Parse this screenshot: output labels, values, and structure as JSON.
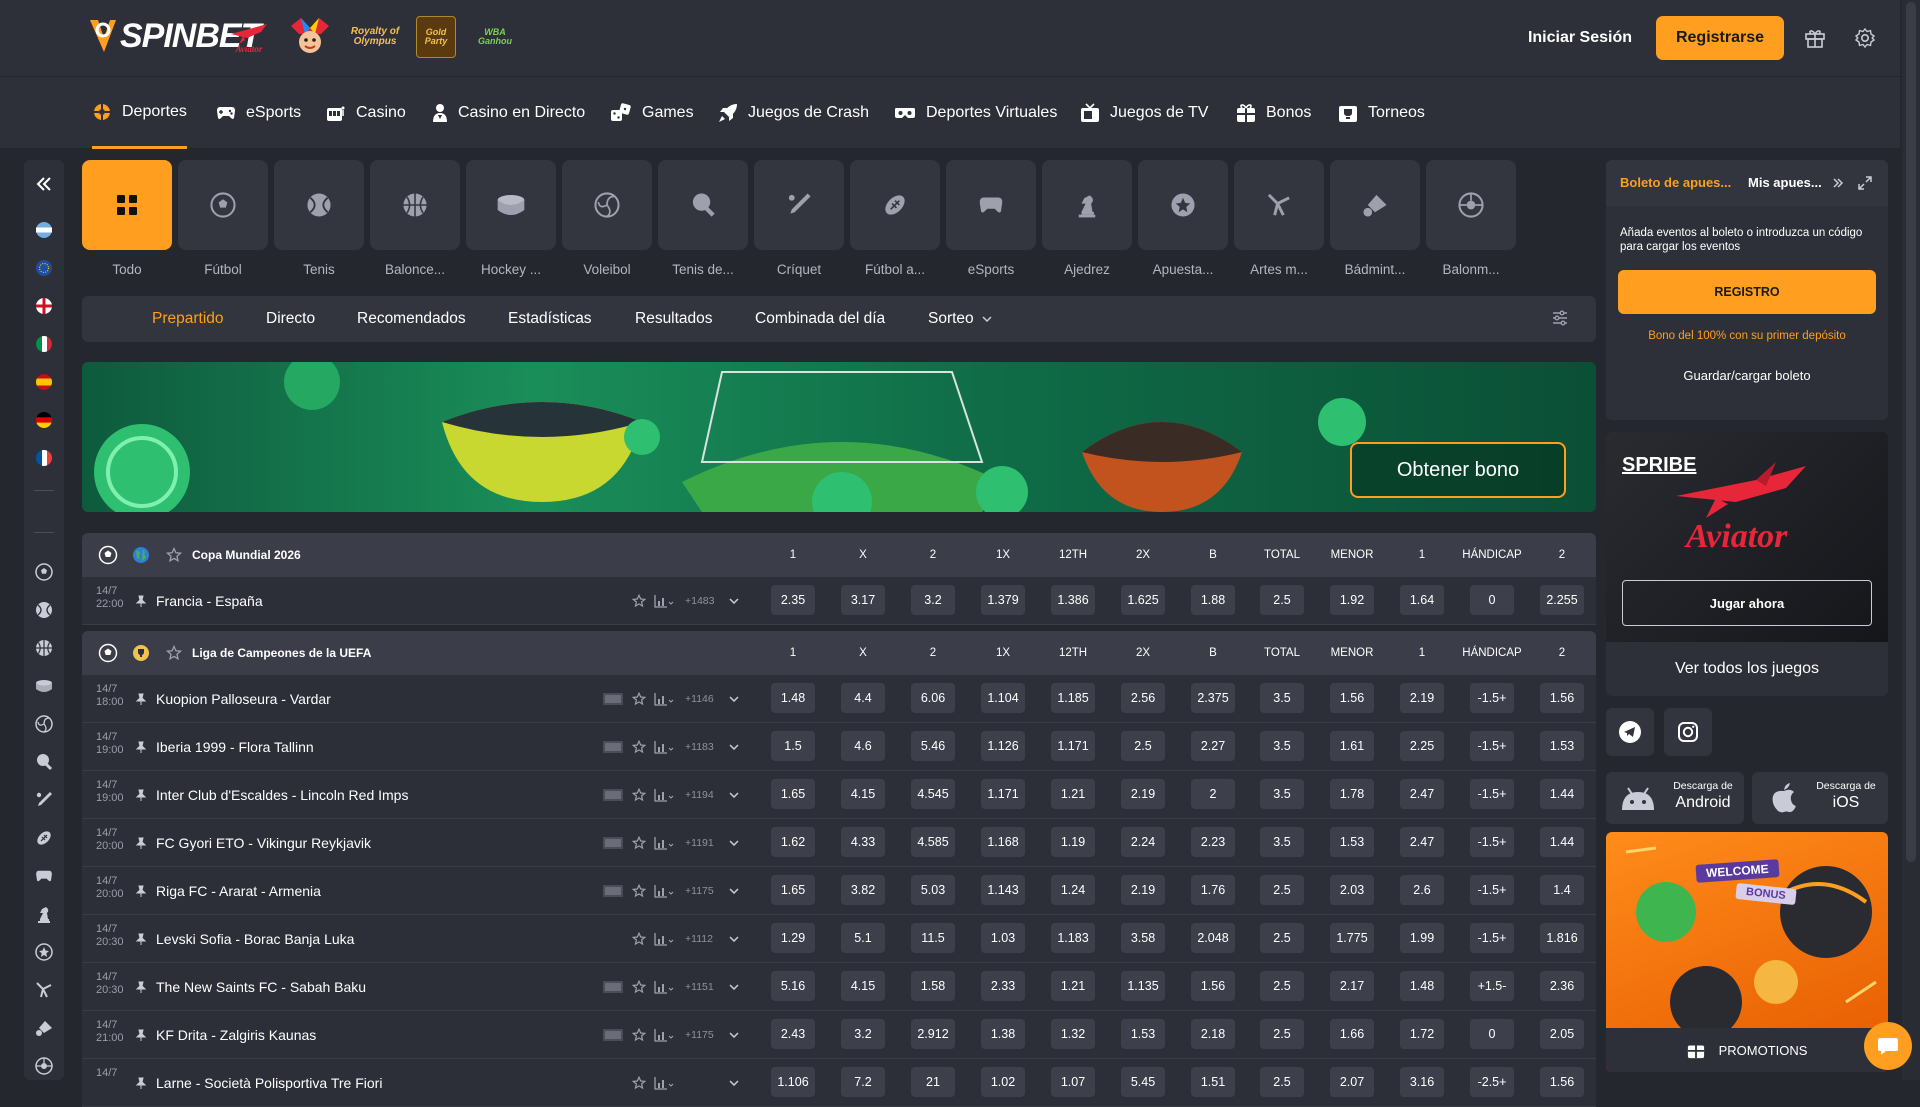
{
  "brand": {
    "logo": "SPINBET"
  },
  "header": {
    "promo_icons": [
      "aviator",
      "joker",
      "Royalty of Olympus",
      "Gold Party",
      "WBA Ganhou"
    ],
    "login": "Iniciar Sesión",
    "register": "Registrarse",
    "icons": [
      "gift-icon",
      "gear-icon"
    ]
  },
  "nav": [
    {
      "label": "Deportes",
      "icon": "sports-icon",
      "active": true
    },
    {
      "label": "eSports",
      "icon": "gamepad-icon"
    },
    {
      "label": "Casino",
      "icon": "slot-icon"
    },
    {
      "label": "Casino en Directo",
      "icon": "dealer-icon"
    },
    {
      "label": "Games",
      "icon": "dice-icon"
    },
    {
      "label": "Juegos de Crash",
      "icon": "rocket-icon"
    },
    {
      "label": "Deportes Virtuales",
      "icon": "vr-icon"
    },
    {
      "label": "Juegos de TV",
      "icon": "tv-icon"
    },
    {
      "label": "Bonos",
      "icon": "gift-icon"
    },
    {
      "label": "Torneos",
      "icon": "trophy-icon"
    }
  ],
  "sports": [
    {
      "label": "Todo",
      "icon": "grid-icon",
      "active": true
    },
    {
      "label": "Fútbol",
      "icon": "soccer-ball-icon"
    },
    {
      "label": "Tenis",
      "icon": "tennis-ball-icon"
    },
    {
      "label": "Balonce...",
      "icon": "basketball-icon"
    },
    {
      "label": "Hockey ...",
      "icon": "hockey-puck-icon"
    },
    {
      "label": "Voleibol",
      "icon": "volleyball-icon"
    },
    {
      "label": "Tenis de...",
      "icon": "table-tennis-icon"
    },
    {
      "label": "Críquet",
      "icon": "cricket-icon"
    },
    {
      "label": "Fútbol a...",
      "icon": "american-football-icon"
    },
    {
      "label": "eSports",
      "icon": "gamepad-icon"
    },
    {
      "label": "Ajedrez",
      "icon": "chess-icon"
    },
    {
      "label": "Apuesta...",
      "icon": "special-bet-icon"
    },
    {
      "label": "Artes m...",
      "icon": "martial-arts-icon"
    },
    {
      "label": "Bádmint...",
      "icon": "shuttlecock-icon"
    },
    {
      "label": "Balonm...",
      "icon": "handball-icon"
    }
  ],
  "subtabs": [
    {
      "label": "Prepartido",
      "active": true
    },
    {
      "label": "Directo"
    },
    {
      "label": "Recomendados"
    },
    {
      "label": "Estadísticas"
    },
    {
      "label": "Resultados"
    },
    {
      "label": "Combinada del día"
    },
    {
      "label": "Sorteo"
    }
  ],
  "banner": {
    "button": "Obtener bono"
  },
  "leagues": [
    {
      "name": "Copa Mundial 2026",
      "headers": [
        "1",
        "X",
        "2",
        "1X",
        "12TH",
        "2X",
        "B",
        "TOTAL",
        "MENOR",
        "1",
        "HÁNDICAP",
        "2"
      ],
      "matches": [
        {
          "date": "14/7",
          "time": "22:00",
          "teams": "Francia - España",
          "count": "+1483",
          "tv": false,
          "odds": [
            "2.35",
            "3.17",
            "3.2",
            "1.379",
            "1.386",
            "1.625",
            "1.88",
            "2.5",
            "1.92",
            "1.64",
            "0",
            "2.255"
          ]
        }
      ]
    },
    {
      "name": "Liga de Campeones de la UEFA",
      "headers": [
        "1",
        "X",
        "2",
        "1X",
        "12TH",
        "2X",
        "B",
        "TOTAL",
        "MENOR",
        "1",
        "HÁNDICAP",
        "2"
      ],
      "matches": [
        {
          "date": "14/7",
          "time": "18:00",
          "teams": "Kuopion Palloseura - Vardar",
          "count": "+1146",
          "tv": true,
          "odds": [
            "1.48",
            "4.4",
            "6.06",
            "1.104",
            "1.185",
            "2.56",
            "2.375",
            "3.5",
            "1.56",
            "2.19",
            "-1.5+",
            "1.56"
          ]
        },
        {
          "date": "14/7",
          "time": "19:00",
          "teams": "Iberia 1999 - Flora Tallinn",
          "count": "+1183",
          "tv": true,
          "odds": [
            "1.5",
            "4.6",
            "5.46",
            "1.126",
            "1.171",
            "2.5",
            "2.27",
            "3.5",
            "1.61",
            "2.25",
            "-1.5+",
            "1.53"
          ]
        },
        {
          "date": "14/7",
          "time": "19:00",
          "teams": "Inter Club d'Escaldes - Lincoln Red Imps",
          "count": "+1194",
          "tv": true,
          "odds": [
            "1.65",
            "4.15",
            "4.545",
            "1.171",
            "1.21",
            "2.19",
            "2",
            "3.5",
            "1.78",
            "2.47",
            "-1.5+",
            "1.44"
          ]
        },
        {
          "date": "14/7",
          "time": "20:00",
          "teams": "FC Gyori ETO - Vikingur Reykjavik",
          "count": "+1191",
          "tv": true,
          "odds": [
            "1.62",
            "4.33",
            "4.585",
            "1.168",
            "1.19",
            "2.24",
            "2.23",
            "3.5",
            "1.53",
            "2.47",
            "-1.5+",
            "1.44"
          ]
        },
        {
          "date": "14/7",
          "time": "20:00",
          "teams": "Riga FC - Ararat - Armenia",
          "count": "+1175",
          "tv": true,
          "odds": [
            "1.65",
            "3.82",
            "5.03",
            "1.143",
            "1.24",
            "2.19",
            "1.76",
            "2.5",
            "2.03",
            "2.6",
            "-1.5+",
            "1.4"
          ]
        },
        {
          "date": "14/7",
          "time": "20:30",
          "teams": "Levski Sofia - Borac Banja Luka",
          "count": "+1112",
          "tv": false,
          "odds": [
            "1.29",
            "5.1",
            "11.5",
            "1.03",
            "1.183",
            "3.58",
            "2.048",
            "2.5",
            "1.775",
            "1.99",
            "-1.5+",
            "1.816"
          ]
        },
        {
          "date": "14/7",
          "time": "20:30",
          "teams": "The New Saints FC - Sabah Baku",
          "count": "+1151",
          "tv": true,
          "odds": [
            "5.16",
            "4.15",
            "1.58",
            "2.33",
            "1.21",
            "1.135",
            "1.56",
            "2.5",
            "2.17",
            "1.48",
            "+1.5-",
            "2.36"
          ]
        },
        {
          "date": "14/7",
          "time": "21:00",
          "teams": "KF Drita - Zalgiris Kaunas",
          "count": "+1175",
          "tv": true,
          "odds": [
            "2.43",
            "3.2",
            "2.912",
            "1.38",
            "1.32",
            "1.53",
            "2.18",
            "2.5",
            "1.66",
            "1.72",
            "0",
            "2.05"
          ]
        },
        {
          "date": "14/7",
          "time": "",
          "teams": "Larne - Società Polisportiva Tre Fiori",
          "count": "",
          "tv": false,
          "odds": [
            "1.106",
            "7.2",
            "21",
            "1.02",
            "1.07",
            "5.45",
            "1.51",
            "2.5",
            "2.07",
            "3.16",
            "-2.5+",
            "1.56"
          ]
        }
      ]
    }
  ],
  "betslip": {
    "tab1": "Boleto de apues...",
    "tab2": "Mis apues...",
    "hint": "Añada eventos al boleto o introduzca un código para cargar los eventos",
    "register": "REGISTRO",
    "bonus": "Bono del 100% con su primer depósito",
    "save": "Guardar/cargar boleto"
  },
  "aviator_card": {
    "brand": "SPRIBE",
    "game": "Aviator",
    "play": "Jugar ahora",
    "all_games": "Ver todos los juegos"
  },
  "downloads": [
    {
      "small": "Descarga de",
      "big": "Android"
    },
    {
      "small": "Descarga de",
      "big": "iOS"
    }
  ],
  "promo": {
    "badge1": "WELCOME",
    "badge2": "BONUS",
    "footer": "PROMOTIONS"
  },
  "colors": {
    "accent": "#ff9e1f",
    "bg": "#25272f",
    "panel": "#2e3039",
    "odds_cell": "#3d404b"
  }
}
